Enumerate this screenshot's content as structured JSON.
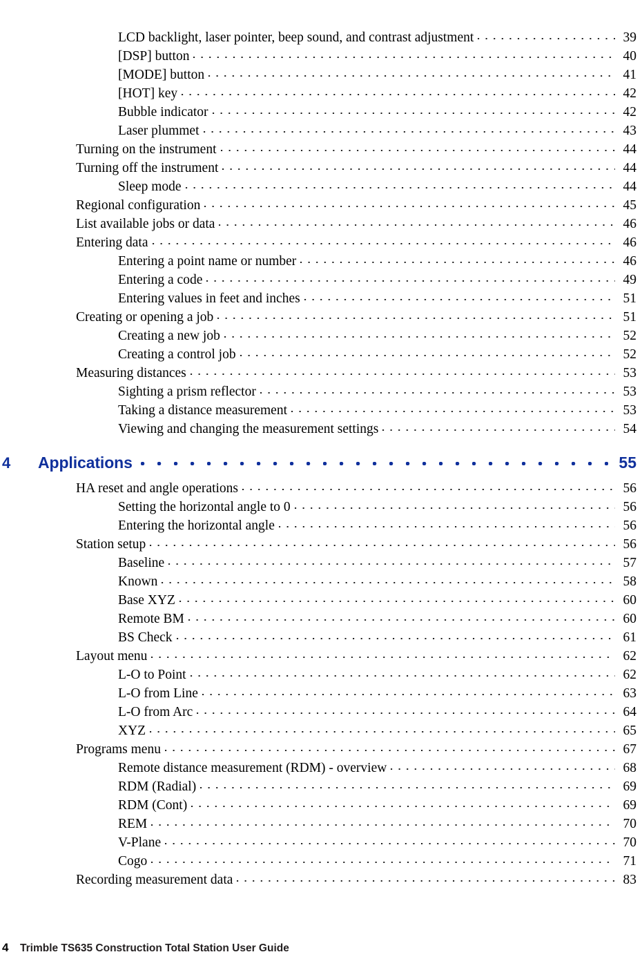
{
  "document": {
    "type": "table-of-contents",
    "accent_color": "#10309c",
    "text_color": "#000000",
    "background_color": "#ffffff"
  },
  "toc": {
    "entries": [
      {
        "level": 2,
        "chapter": "",
        "title": "LCD backlight, laser pointer, beep sound, and contrast adjustment",
        "page": "39"
      },
      {
        "level": 2,
        "chapter": "",
        "title": "[DSP] button",
        "page": "40"
      },
      {
        "level": 2,
        "chapter": "",
        "title": "[MODE] button",
        "page": "41"
      },
      {
        "level": 2,
        "chapter": "",
        "title": "[HOT] key",
        "page": "42"
      },
      {
        "level": 2,
        "chapter": "",
        "title": "Bubble indicator",
        "page": "42"
      },
      {
        "level": 2,
        "chapter": "",
        "title": "Laser plummet",
        "page": "43"
      },
      {
        "level": 1,
        "chapter": "",
        "title": "Turning on the instrument",
        "page": "44"
      },
      {
        "level": 1,
        "chapter": "",
        "title": "Turning off the instrument",
        "page": "44"
      },
      {
        "level": 2,
        "chapter": "",
        "title": "Sleep mode",
        "page": "44"
      },
      {
        "level": 1,
        "chapter": "",
        "title": "Regional configuration",
        "page": "45"
      },
      {
        "level": 1,
        "chapter": "",
        "title": "List available jobs or data",
        "page": "46"
      },
      {
        "level": 1,
        "chapter": "",
        "title": "Entering data",
        "page": "46"
      },
      {
        "level": 2,
        "chapter": "",
        "title": "Entering a point name or number",
        "page": "46"
      },
      {
        "level": 2,
        "chapter": "",
        "title": "Entering a code",
        "page": "49"
      },
      {
        "level": 2,
        "chapter": "",
        "title": "Entering values in feet and inches",
        "page": "51"
      },
      {
        "level": 1,
        "chapter": "",
        "title": "Creating or opening a job",
        "page": "51"
      },
      {
        "level": 2,
        "chapter": "",
        "title": "Creating a new job",
        "page": "52"
      },
      {
        "level": 2,
        "chapter": "",
        "title": "Creating a control job",
        "page": "52"
      },
      {
        "level": 1,
        "chapter": "",
        "title": "Measuring distances",
        "page": "53"
      },
      {
        "level": 2,
        "chapter": "",
        "title": "Sighting a prism reflector",
        "page": "53"
      },
      {
        "level": 2,
        "chapter": "",
        "title": "Taking a distance measurement",
        "page": "53"
      },
      {
        "level": 2,
        "chapter": "",
        "title": "Viewing and changing the measurement settings",
        "page": "54"
      },
      {
        "level": 0,
        "chapter": "4",
        "title": "Applications",
        "page": "55"
      },
      {
        "level": 1,
        "chapter": "",
        "title": "HA reset and angle operations",
        "page": "56"
      },
      {
        "level": 2,
        "chapter": "",
        "title": "Setting the horizontal angle to 0",
        "page": "56"
      },
      {
        "level": 2,
        "chapter": "",
        "title": "Entering the horizontal angle",
        "page": "56"
      },
      {
        "level": 1,
        "chapter": "",
        "title": "Station setup",
        "page": "56"
      },
      {
        "level": 2,
        "chapter": "",
        "title": "Baseline",
        "page": "57"
      },
      {
        "level": 2,
        "chapter": "",
        "title": "Known",
        "page": "58"
      },
      {
        "level": 2,
        "chapter": "",
        "title": "Base XYZ",
        "page": "60"
      },
      {
        "level": 2,
        "chapter": "",
        "title": "Remote BM",
        "page": "60"
      },
      {
        "level": 2,
        "chapter": "",
        "title": "BS Check",
        "page": "61"
      },
      {
        "level": 1,
        "chapter": "",
        "title": "Layout menu",
        "page": "62"
      },
      {
        "level": 2,
        "chapter": "",
        "title": "L-O to Point",
        "page": "62"
      },
      {
        "level": 2,
        "chapter": "",
        "title": "L-O from Line",
        "page": "63"
      },
      {
        "level": 2,
        "chapter": "",
        "title": "L-O from Arc",
        "page": "64"
      },
      {
        "level": 2,
        "chapter": "",
        "title": "XYZ",
        "page": "65"
      },
      {
        "level": 1,
        "chapter": "",
        "title": "Programs menu",
        "page": "67"
      },
      {
        "level": 2,
        "chapter": "",
        "title": "Remote distance measurement (RDM) - overview",
        "page": "68"
      },
      {
        "level": 2,
        "chapter": "",
        "title": "RDM (Radial)",
        "page": "69"
      },
      {
        "level": 2,
        "chapter": "",
        "title": "RDM (Cont)",
        "page": "69"
      },
      {
        "level": 2,
        "chapter": "",
        "title": "REM",
        "page": "70"
      },
      {
        "level": 2,
        "chapter": "",
        "title": "V-Plane",
        "page": "70"
      },
      {
        "level": 2,
        "chapter": "",
        "title": "Cogo",
        "page": "71"
      },
      {
        "level": 1,
        "chapter": "",
        "title": "Recording measurement data",
        "page": "83"
      }
    ]
  },
  "footer": {
    "page_number": "4",
    "text": "Trimble TS635 Construction Total Station User Guide"
  }
}
